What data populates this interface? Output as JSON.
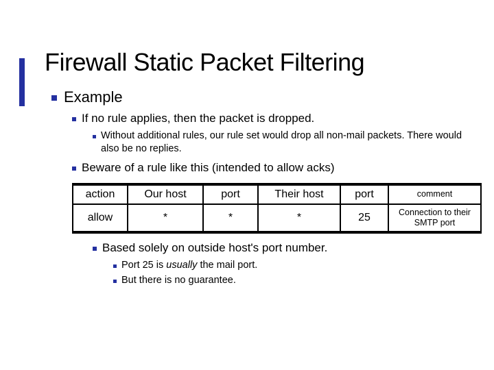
{
  "title": "Firewall Static Packet Filtering",
  "bullets": {
    "l1": "Example",
    "l2a": "If no rule applies, then the packet is dropped.",
    "l3a": "Without additional rules, our rule set would drop all non-mail packets. There would also be no replies.",
    "l2b": "Beware of a rule like this (intended to allow acks)",
    "l2c": "Based solely on outside host's port number.",
    "l3c1_pre": "Port 25 is ",
    "l3c1_em": "usually",
    "l3c1_post": " the mail port.",
    "l3c2": "But there is no guarantee."
  },
  "table": {
    "headers": {
      "action": "action",
      "ourhost": "Our host",
      "port1": "port",
      "theirhost": "Their host",
      "port2": "port",
      "comment": "comment"
    },
    "row": {
      "action": "allow",
      "ourhost": "*",
      "port1": "*",
      "theirhost": "*",
      "port2": "25",
      "comment": "Connection to their SMTP port"
    }
  }
}
